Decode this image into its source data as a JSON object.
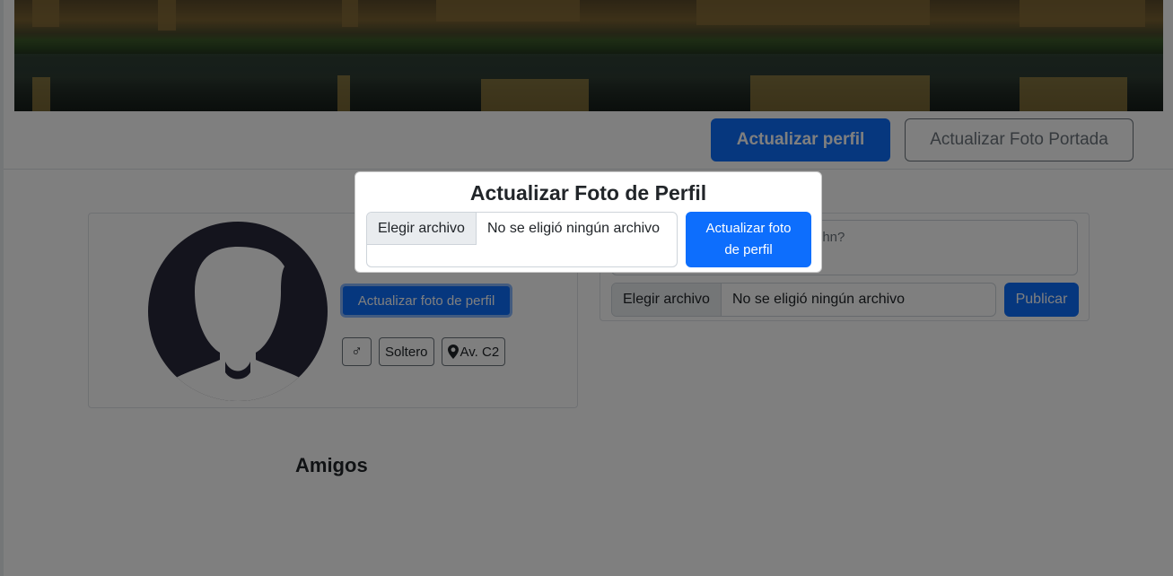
{
  "header": {
    "update_profile_label": "Actualizar perfil",
    "update_cover_label": "Actualizar Foto Portada"
  },
  "profile": {
    "update_photo_label": "Actualizar foto de perfil",
    "gender_symbol": "♂",
    "relationship": "Soltero",
    "location": "Av. C2",
    "friends_title": "Amigos"
  },
  "post": {
    "placeholder_visible": "ohn?",
    "file_button": "Elegir archivo",
    "file_status": "No se eligió ningún archivo",
    "publish_label": "Publicar"
  },
  "modal": {
    "title": "Actualizar Foto de Perfil",
    "file_button": "Elegir archivo",
    "file_status": "No se eligió ningún archivo",
    "submit_label": "Actualizar foto de perfil"
  },
  "colors": {
    "primary": "#0d6efd",
    "avatar_bg": "#28293a"
  },
  "icons": {
    "gender": "male-icon",
    "location": "map-pin-icon"
  }
}
